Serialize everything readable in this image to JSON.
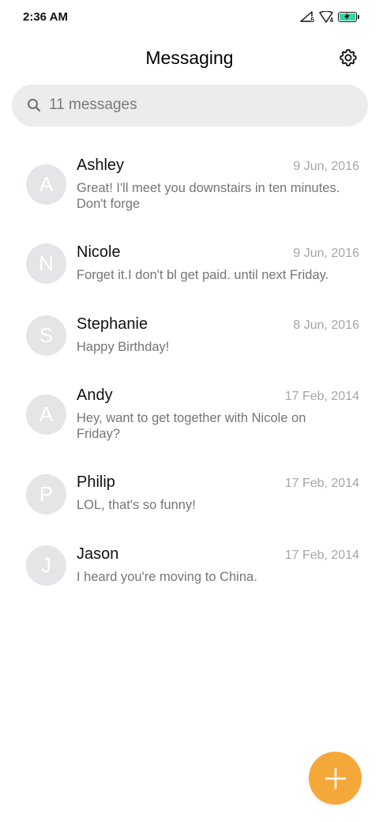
{
  "status_bar": {
    "time": "2:36 AM",
    "signal1_label": "5",
    "signal2_label": "4",
    "battery_color": "#35d6a3"
  },
  "header": {
    "title": "Messaging",
    "settings_icon": "gear-icon"
  },
  "search": {
    "placeholder": "11 messages",
    "icon": "search-icon"
  },
  "conversations": [
    {
      "initial": "A",
      "name": "Ashley",
      "date": "9 Jun, 2016",
      "preview": "Great! I'll meet you downstairs in ten minutes. Don't forge"
    },
    {
      "initial": "N",
      "name": "Nicole",
      "date": "9 Jun, 2016",
      "preview": "Forget it.I don't bl get paid. until next Friday."
    },
    {
      "initial": "S",
      "name": "Stephanie",
      "date": "8 Jun, 2016",
      "preview": "Happy Birthday!"
    },
    {
      "initial": "A",
      "name": "Andy",
      "date": "17 Feb, 2014",
      "preview": "Hey, want to get together with Nicole on Friday?"
    },
    {
      "initial": "P",
      "name": "Philip",
      "date": "17 Feb, 2014",
      "preview": "LOL, that's so funny!"
    },
    {
      "initial": "J",
      "name": "Jason",
      "date": "17 Feb, 2014",
      "preview": "I heard you're moving to China."
    }
  ],
  "fab": {
    "icon": "plus-icon",
    "color": "#f5a83a"
  }
}
